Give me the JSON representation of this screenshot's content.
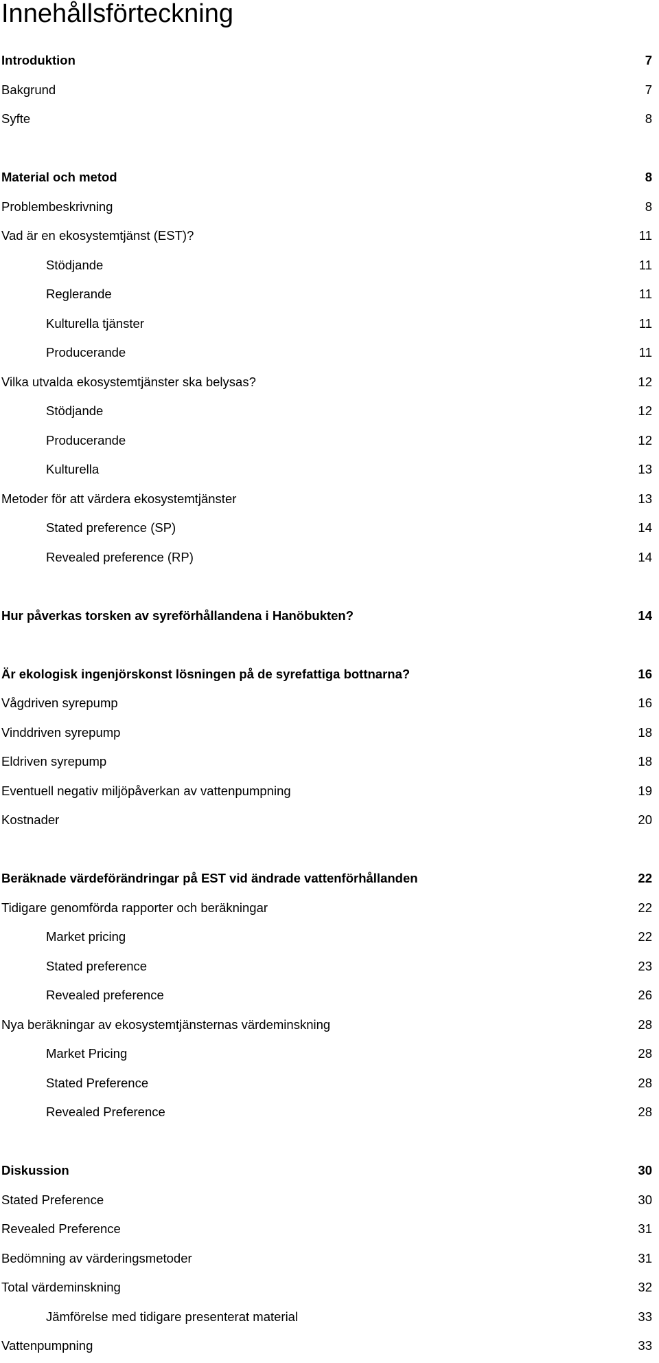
{
  "document": {
    "title": "Innehållsförteckning",
    "entries": [
      {
        "label": "Introduktion",
        "page": "7",
        "level": 1,
        "bold": true
      },
      {
        "label": "Bakgrund",
        "page": "7",
        "level": 1,
        "bold": false
      },
      {
        "label": "Syfte",
        "page": "8",
        "level": 1,
        "bold": false
      },
      {
        "gap": true
      },
      {
        "label": "Material och metod",
        "page": "8",
        "level": 1,
        "bold": true
      },
      {
        "label": "Problembeskrivning",
        "page": "8",
        "level": 1,
        "bold": false
      },
      {
        "label": "Vad är en ekosystemtjänst (EST)?",
        "page": "11",
        "level": 1,
        "bold": false
      },
      {
        "label": "Stödjande",
        "page": "11",
        "level": 2,
        "bold": false
      },
      {
        "label": "Reglerande",
        "page": "11",
        "level": 2,
        "bold": false
      },
      {
        "label": "Kulturella tjänster",
        "page": "11",
        "level": 2,
        "bold": false
      },
      {
        "label": "Producerande",
        "page": "11",
        "level": 2,
        "bold": false
      },
      {
        "label": "Vilka utvalda ekosystemtjänster ska belysas?",
        "page": "12",
        "level": 1,
        "bold": false
      },
      {
        "label": "Stödjande",
        "page": "12",
        "level": 2,
        "bold": false
      },
      {
        "label": "Producerande",
        "page": "12",
        "level": 2,
        "bold": false
      },
      {
        "label": "Kulturella",
        "page": "13",
        "level": 2,
        "bold": false
      },
      {
        "label": "Metoder för att värdera ekosystemtjänster",
        "page": "13",
        "level": 1,
        "bold": false
      },
      {
        "label": "Stated preference (SP)",
        "page": "14",
        "level": 2,
        "bold": false
      },
      {
        "label": "Revealed preference (RP)",
        "page": "14",
        "level": 2,
        "bold": false
      },
      {
        "gap": true
      },
      {
        "label": "Hur påverkas torsken av syreförhållandena i Hanöbukten?",
        "page": "14",
        "level": 1,
        "bold": true
      },
      {
        "gap": true
      },
      {
        "label": "Är ekologisk ingenjörskonst lösningen på de syrefattiga bottnarna?",
        "page": "16",
        "level": 1,
        "bold": true
      },
      {
        "label": "Vågdriven syrepump",
        "page": "16",
        "level": 1,
        "bold": false
      },
      {
        "label": "Vinddriven syrepump",
        "page": "18",
        "level": 1,
        "bold": false
      },
      {
        "label": "Eldriven syrepump",
        "page": "18",
        "level": 1,
        "bold": false
      },
      {
        "label": "Eventuell negativ miljöpåverkan av vattenpumpning",
        "page": "19",
        "level": 1,
        "bold": false
      },
      {
        "label": "Kostnader",
        "page": "20",
        "level": 1,
        "bold": false
      },
      {
        "gap": true
      },
      {
        "label": "Beräknade värdeförändringar på EST vid ändrade vattenförhållanden",
        "page": "22",
        "level": 1,
        "bold": true
      },
      {
        "label": "Tidigare genomförda rapporter och beräkningar",
        "page": "22",
        "level": 1,
        "bold": false
      },
      {
        "label": "Market pricing",
        "page": "22",
        "level": 2,
        "bold": false
      },
      {
        "label": "Stated preference",
        "page": "23",
        "level": 2,
        "bold": false
      },
      {
        "label": "Revealed preference",
        "page": "26",
        "level": 2,
        "bold": false
      },
      {
        "label": "Nya beräkningar av ekosystemtjänsternas värdeminskning",
        "page": "28",
        "level": 1,
        "bold": false
      },
      {
        "label": "Market Pricing",
        "page": "28",
        "level": 2,
        "bold": false
      },
      {
        "label": "Stated Preference",
        "page": "28",
        "level": 2,
        "bold": false
      },
      {
        "label": "Revealed Preference",
        "page": "28",
        "level": 2,
        "bold": false
      },
      {
        "gap": true
      },
      {
        "label": "Diskussion",
        "page": "30",
        "level": 1,
        "bold": true
      },
      {
        "label": "Stated Preference",
        "page": "30",
        "level": 1,
        "bold": false
      },
      {
        "label": "Revealed Preference",
        "page": "31",
        "level": 1,
        "bold": false
      },
      {
        "label": "Bedömning av värderingsmetoder",
        "page": "31",
        "level": 1,
        "bold": false
      },
      {
        "label": "Total värdeminskning",
        "page": "32",
        "level": 1,
        "bold": false
      },
      {
        "label": "Jämförelse med tidigare presenterat material",
        "page": "33",
        "level": 2,
        "bold": false
      },
      {
        "label": "Vattenpumpning",
        "page": "33",
        "level": 1,
        "bold": false
      }
    ]
  }
}
